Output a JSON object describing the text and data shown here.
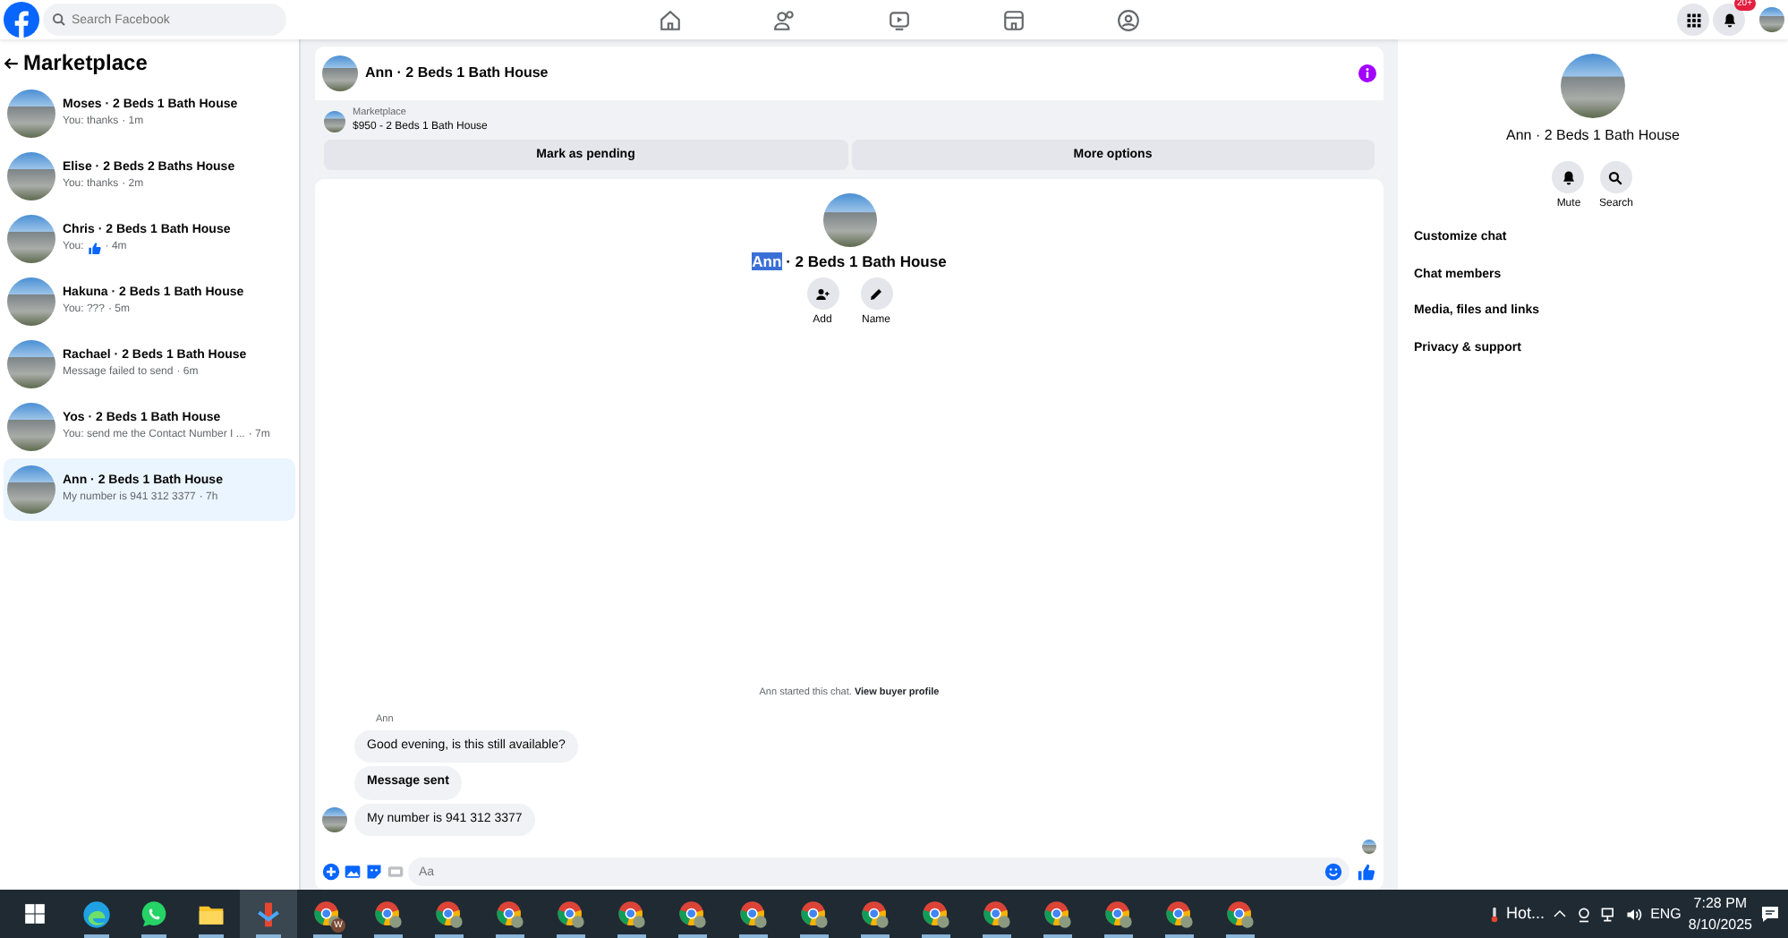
{
  "topbar": {
    "search": {
      "placeholder": "Search Facebook"
    },
    "nav": [
      {
        "kind": "home",
        "selected": false
      },
      {
        "kind": "friends",
        "selected": false
      },
      {
        "kind": "video",
        "selected": false
      },
      {
        "kind": "marketplace",
        "selected": false
      },
      {
        "kind": "groups",
        "selected": false
      }
    ],
    "notification_badge": "20+"
  },
  "sidebar": {
    "title": "Marketplace",
    "conversations": [
      {
        "title": "Moses · 2 Beds 1 Bath House",
        "preview": "You: thanks",
        "like": false,
        "time": "· 1m",
        "selected": false
      },
      {
        "title": "Elise · 2 Beds 2 Baths House",
        "preview": "You: thanks",
        "like": false,
        "time": "· 2m",
        "selected": false
      },
      {
        "title": "Chris · 2 Beds 1 Bath House",
        "preview": "You:",
        "like": true,
        "time": "· 4m",
        "selected": false
      },
      {
        "title": "Hakuna · 2 Beds 1 Bath House",
        "preview": "You: ???",
        "like": false,
        "time": "· 5m",
        "selected": false
      },
      {
        "title": "Rachael · 2 Beds 1 Bath House",
        "preview": "Message failed to send",
        "like": false,
        "time": "· 6m",
        "selected": false
      },
      {
        "title": "Yos · 2 Beds 1 Bath House",
        "preview": "You: send me the Contact Number I ...",
        "like": false,
        "time": "· 7m",
        "selected": false
      },
      {
        "title": "Ann · 2 Beds 1 Bath House",
        "preview": "My number is 941 312 3377",
        "like": false,
        "time": "· 7h",
        "selected": true
      }
    ]
  },
  "chat": {
    "header_title": "Ann · 2 Beds 1 Bath House",
    "listing": {
      "source": "Marketplace",
      "summary": "$950 - 2 Beds 1 Bath House",
      "buttons": [
        "Mark as pending",
        "More options"
      ]
    },
    "profile": {
      "name_selected": "Ann",
      "name_rest": "· 2 Beds 1 Bath House",
      "actions": [
        {
          "kind": "add",
          "label": "Add"
        },
        {
          "kind": "name",
          "label": "Name"
        }
      ]
    },
    "started_text": "Ann started this chat.",
    "started_link": "View buyer profile",
    "sender": "Ann",
    "messages": [
      {
        "text": "Good evening, is this still available?",
        "bold": false,
        "avatar": false
      },
      {
        "text": "Message sent",
        "bold": true,
        "avatar": false
      },
      {
        "text": "My number is 941 312 3377",
        "bold": false,
        "avatar": true
      }
    ],
    "composer": {
      "placeholder": "Aa"
    }
  },
  "details": {
    "name": "Ann · 2 Beds 1 Bath House",
    "actions": [
      {
        "kind": "mute",
        "label": "Mute"
      },
      {
        "kind": "search",
        "label": "Search"
      }
    ],
    "menu": [
      "Customize chat",
      "Chat members",
      "Media, files and links",
      "Privacy & support"
    ]
  },
  "taskbar": {
    "apps": [
      {
        "kind": "edge",
        "selected": false
      },
      {
        "kind": "whatsapp",
        "selected": false
      },
      {
        "kind": "explorer",
        "selected": false
      },
      {
        "kind": "app",
        "selected": true
      },
      {
        "kind": "chrome",
        "badge": "W",
        "selected": false
      },
      {
        "kind": "chrome",
        "selected": false
      },
      {
        "kind": "chrome",
        "selected": false
      },
      {
        "kind": "chrome",
        "selected": false
      },
      {
        "kind": "chrome",
        "selected": false
      },
      {
        "kind": "chrome",
        "selected": false
      },
      {
        "kind": "chrome",
        "selected": false
      },
      {
        "kind": "chrome",
        "selected": false
      },
      {
        "kind": "chrome",
        "selected": false
      },
      {
        "kind": "chrome",
        "selected": false
      },
      {
        "kind": "chrome",
        "selected": false
      },
      {
        "kind": "chrome",
        "selected": false
      },
      {
        "kind": "chrome",
        "selected": false
      },
      {
        "kind": "chrome",
        "selected": false
      },
      {
        "kind": "chrome",
        "selected": false
      },
      {
        "kind": "chrome",
        "selected": false
      }
    ],
    "weather": "Hot...",
    "language": "ENG",
    "time": "7:28 PM",
    "date": "8/10/2025"
  }
}
